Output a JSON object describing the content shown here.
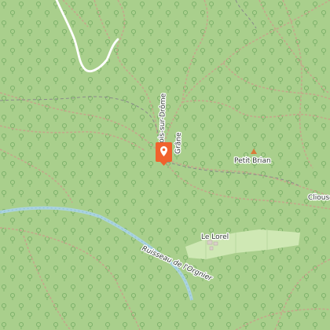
{
  "map": {
    "labels": {
      "road_label": "Bois-sur-Drôme",
      "road_label_2": "Grâne",
      "peak": "Petit Brian",
      "hamlet": "Le Lorel",
      "stream": "Ruisseau de l'Orgnier",
      "edge_place": "Cliousc"
    },
    "marker": {
      "icon": "map-pin-icon",
      "color": "#f0622d"
    },
    "colors": {
      "forest": "#a9cf8c",
      "meadow": "#cfe8b4",
      "water": "#aad3df",
      "track_white": "#ffffff",
      "track_dash": "#c4a88a",
      "path_dash": "#8a8a8a",
      "peak": "#d97a3a"
    }
  }
}
